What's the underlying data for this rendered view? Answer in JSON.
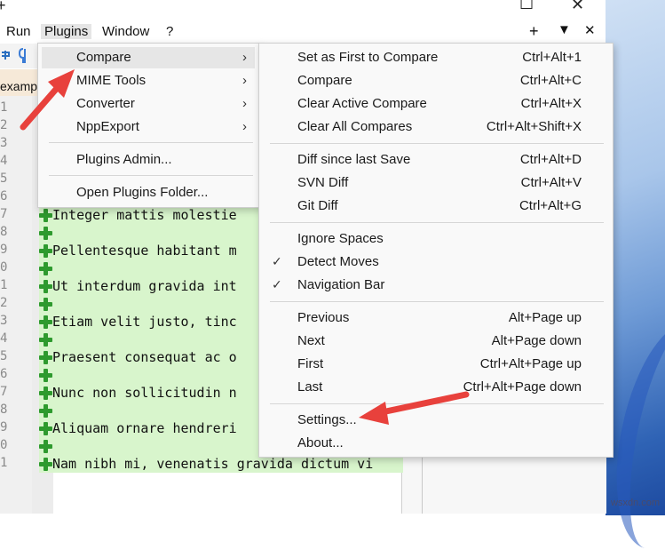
{
  "window": {
    "title_glyph": "+",
    "restore_icon": "☐",
    "close_icon": "✕"
  },
  "menubar": {
    "items": [
      "Run",
      "Plugins",
      "Window",
      "?"
    ],
    "right_buttons": [
      "+",
      "▼",
      "✕"
    ]
  },
  "tab": {
    "label": "examp"
  },
  "line_numbers": [
    "1",
    "2",
    "3",
    "4",
    "5",
    "6",
    "7",
    "8",
    "9",
    "0",
    "1",
    "2",
    "3",
    "4",
    "5",
    "6",
    "7",
    "8",
    "9",
    "0",
    "1"
  ],
  "code_lines": [
    "Integer mattis molestie",
    "Pellentesque habitant m",
    "Ut interdum gravida int",
    "Etiam velit justo, tinc",
    "Praesent consequat ac o",
    "Nunc non sollicitudin n",
    "Aliquam ornare hendreri",
    "Nam nibh mi, venenatis gravida dictum vi"
  ],
  "plugins_menu": {
    "items": [
      {
        "label": "Compare",
        "arrow": "›",
        "highlighted": true
      },
      {
        "label": "MIME Tools",
        "arrow": "›"
      },
      {
        "label": "Converter",
        "arrow": "›"
      },
      {
        "label": "NppExport",
        "arrow": "›"
      },
      {
        "label": "Plugins Admin..."
      },
      {
        "label": "Open Plugins Folder..."
      }
    ]
  },
  "compare_menu": {
    "items": [
      {
        "label": "Set as First to Compare",
        "shortcut": "Ctrl+Alt+1"
      },
      {
        "label": "Compare",
        "shortcut": "Ctrl+Alt+C"
      },
      {
        "label": "Clear Active Compare",
        "shortcut": "Ctrl+Alt+X"
      },
      {
        "label": "Clear All Compares",
        "shortcut": "Ctrl+Alt+Shift+X"
      },
      {
        "label": "Diff since last Save",
        "shortcut": "Ctrl+Alt+D"
      },
      {
        "label": "SVN Diff",
        "shortcut": "Ctrl+Alt+V"
      },
      {
        "label": "Git Diff",
        "shortcut": "Ctrl+Alt+G"
      },
      {
        "label": "Ignore Spaces",
        "shortcut": ""
      },
      {
        "label": "Detect Moves",
        "shortcut": "",
        "checked": true
      },
      {
        "label": "Navigation Bar",
        "shortcut": "",
        "checked": true
      },
      {
        "label": "Previous",
        "shortcut": "Alt+Page up"
      },
      {
        "label": "Next",
        "shortcut": "Alt+Page down"
      },
      {
        "label": "First",
        "shortcut": "Ctrl+Alt+Page up"
      },
      {
        "label": "Last",
        "shortcut": "Ctrl+Alt+Page down"
      },
      {
        "label": "Settings...",
        "shortcut": ""
      },
      {
        "label": "About...",
        "shortcut": ""
      }
    ],
    "check_glyph": "✓"
  },
  "watermark": "wsxdn.com",
  "colors": {
    "accent_arrow": "#e8413c",
    "diff_added": "#d8f5cc",
    "plus_green": "#2e9a2e",
    "highlight": "#e6e6e6"
  }
}
